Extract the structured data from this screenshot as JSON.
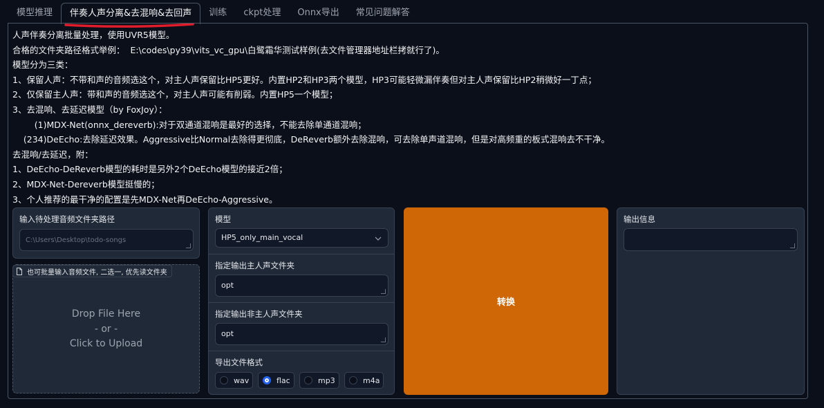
{
  "tabs": [
    {
      "label": "模型推理"
    },
    {
      "label": "伴奏人声分离&去混响&去回声"
    },
    {
      "label": "训练"
    },
    {
      "label": "ckpt处理"
    },
    {
      "label": "Onnx导出"
    },
    {
      "label": "常见问题解答"
    }
  ],
  "description": [
    "人声伴奏分离批量处理，使用UVR5模型。",
    "合格的文件夹路径格式举例：  E:\\codes\\py39\\vits_vc_gpu\\白鹭霜华测试样例(去文件管理器地址栏拷就行了)。",
    "模型分为三类：",
    "1、保留人声：不带和声的音频选这个，对主人声保留比HP5更好。内置HP2和HP3两个模型，HP3可能轻微漏伴奏但对主人声保留比HP2稍微好一丁点；",
    "2、仅保留主人声：带和声的音频选这个，对主人声可能有削弱。内置HP5一个模型；",
    "3、去混响、去延迟模型（by FoxJoy）：",
    "        (1)MDX-Net(onnx_dereverb):对于双通道混响是最好的选择，不能去除单通道混响；",
    "    (234)DeEcho:去除延迟效果。Aggressive比Normal去除得更彻底，DeReverb额外去除混响，可去除单声道混响，但是对高频重的板式混响去不干净。",
    "去混响/去延迟，附：",
    "1、DeEcho-DeReverb模型的耗时是另外2个DeEcho模型的接近2倍；",
    "2、MDX-Net-Dereverb模型挺慢的；",
    "3、个人推荐的最干净的配置是先MDX-Net再DeEcho-Aggressive。"
  ],
  "input_dir": {
    "label": "输入待处理音频文件夹路径",
    "placeholder": "C:\\Users\\Desktop\\todo-songs"
  },
  "upload": {
    "chip_label": "也可批量输入音频文件, 二选一, 优先读文件夹",
    "line1": "Drop File Here",
    "line2": "- or -",
    "line3": "Click to Upload"
  },
  "model": {
    "label": "模型",
    "value": "HP5_only_main_vocal"
  },
  "vocal_dir": {
    "label": "指定输出主人声文件夹",
    "value": "opt"
  },
  "instrumental_dir": {
    "label": "指定输出非主人声文件夹",
    "value": "opt"
  },
  "format": {
    "label": "导出文件格式",
    "options": [
      "wav",
      "flac",
      "mp3",
      "m4a"
    ],
    "selected": "flac"
  },
  "convert_label": "转换",
  "output": {
    "label": "输出信息",
    "value": ""
  },
  "colors": {
    "accent": "#d06706",
    "background": "#0b0f19",
    "panel": "#1f2937",
    "annotation_line": "#e11d2b"
  }
}
